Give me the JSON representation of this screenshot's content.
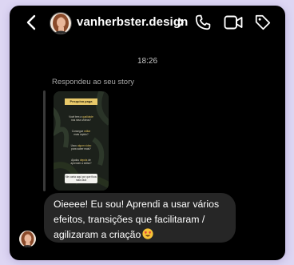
{
  "header": {
    "username": "vanherbster.design",
    "back_icon": "chevron-left-icon",
    "profile_chevron_icon": "chevron-right-icon",
    "actions": [
      {
        "icon": "phone-icon"
      },
      {
        "icon": "video-camera-icon"
      },
      {
        "icon": "tag-icon"
      }
    ]
  },
  "thread": {
    "timestamp": "18:26",
    "reply_label": "Respondeu ao seu story",
    "story": {
      "title": "Pesquisa paga",
      "lines": [
        {
          "pre": "Você tem a ",
          "hl": "qualidade",
          "post": ""
        },
        {
          "pre": "nos seus vídeos?",
          "hl": "",
          "post": ""
        },
        {
          "pre": "Consegue ",
          "hl": "editar",
          "post": ""
        },
        {
          "pre": "mais rápido?",
          "hl": "",
          "post": ""
        },
        {
          "pre": "Usou ",
          "hl": "algum vídeo",
          "post": ""
        },
        {
          "pre": "para saber mais?",
          "hl": "",
          "post": ""
        },
        {
          "pre": "Ajudou ",
          "hl": "depois",
          "post": " de"
        },
        {
          "pre": "aprender a editar?",
          "hl": "",
          "post": ""
        }
      ],
      "box_text": "Me conta aqui por que ficou mais fácil"
    },
    "message": {
      "lines": [
        "Oieeee! Eu sou! Aprendi a usar vários",
        "efeitos, transições que facilitaram /",
        "agilizaram a criação"
      ],
      "emoji": "smiling-face-with-heart-eyes-icon"
    }
  },
  "colors": {
    "background": "#000000",
    "bubble": "#262626",
    "page": "#ddd6f3",
    "story_accent": "#e1c25f"
  }
}
